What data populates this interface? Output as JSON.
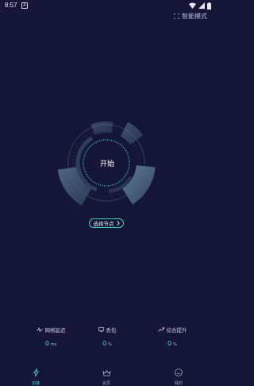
{
  "status_bar": {
    "time": "8:57",
    "notification_glyph": "A",
    "icons": [
      "notification-icon",
      "wifi-icon",
      "signal-icon",
      "battery-icon"
    ]
  },
  "header": {
    "smart_mode_label": "智能模式",
    "smart_mode_icon": "expand-icon"
  },
  "gauge": {
    "start_label": "开始",
    "accent_color": "#3fd1c6"
  },
  "node_button": {
    "label": "选择节点",
    "icon": "chevron-right-icon"
  },
  "stats": [
    {
      "label": "网络延迟",
      "value": "0",
      "unit": "ms",
      "icon": "pulse-icon"
    },
    {
      "label": "丢包",
      "value": "0",
      "unit": "%",
      "icon": "monitor-icon"
    },
    {
      "label": "综合提升",
      "value": "0",
      "unit": "%",
      "icon": "trend-up-icon"
    }
  ],
  "nav": [
    {
      "label": "加速",
      "icon": "bolt-icon",
      "active": true
    },
    {
      "label": "会员",
      "icon": "crown-icon",
      "active": false
    },
    {
      "label": "我的",
      "icon": "smiley-icon",
      "active": false
    }
  ],
  "colors": {
    "background": "#151637",
    "accent": "#3fd1c6",
    "ring": "#4e6a86"
  }
}
